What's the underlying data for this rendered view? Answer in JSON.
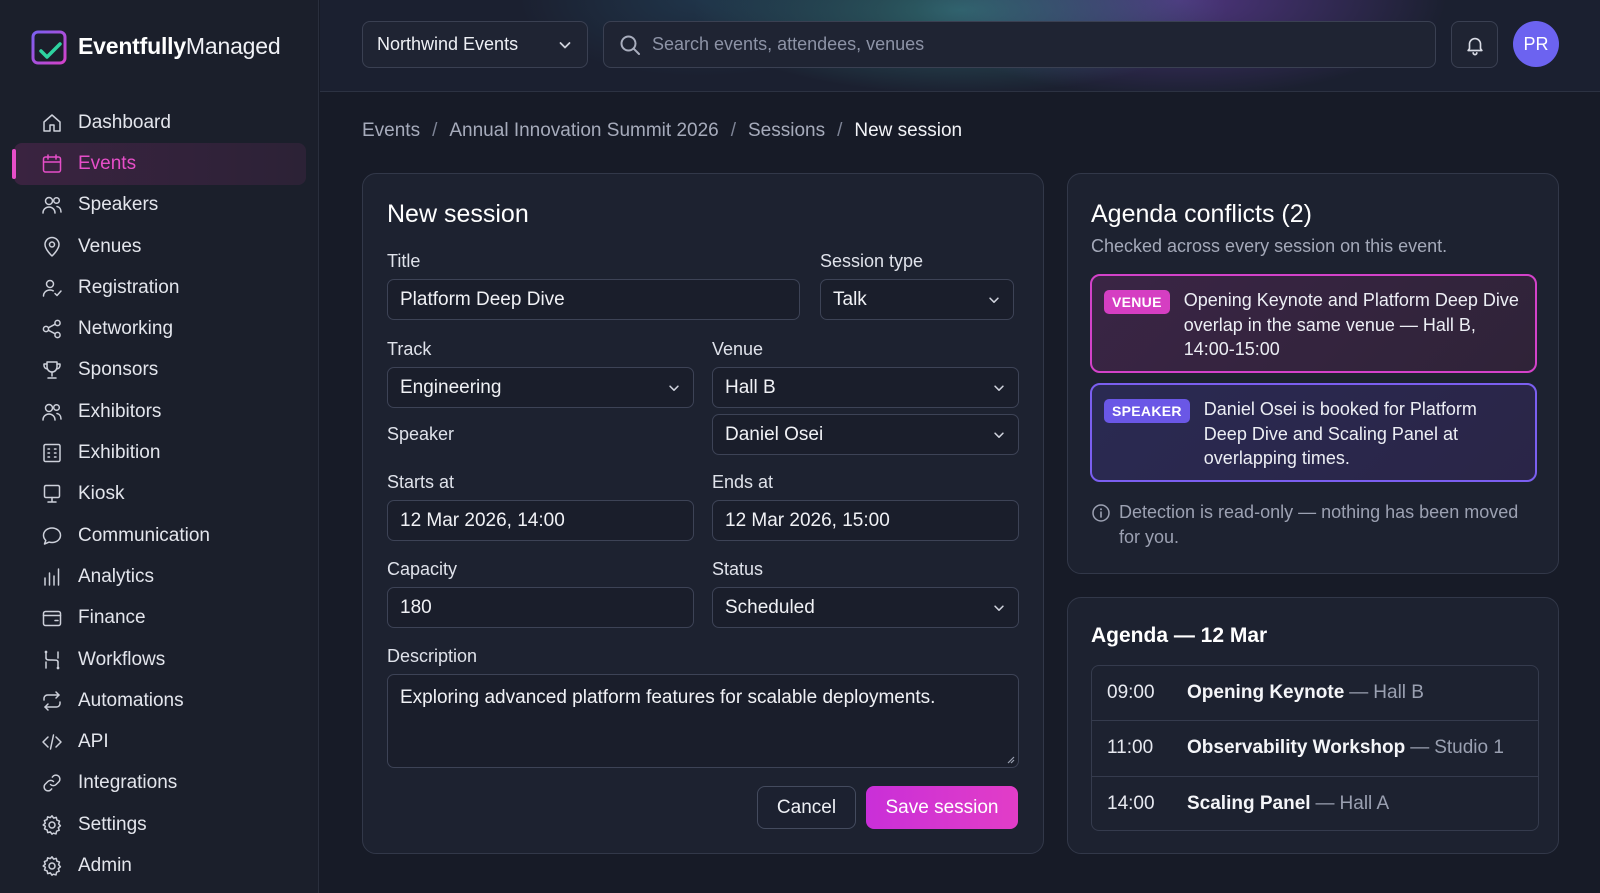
{
  "brand": {
    "name_strong": "Eventfully",
    "name_light": "Managed"
  },
  "sidebar": {
    "items": [
      {
        "label": "Dashboard",
        "icon": "home-icon",
        "active": false
      },
      {
        "label": "Events",
        "icon": "calendar-icon",
        "active": true
      },
      {
        "label": "Speakers",
        "icon": "users-icon",
        "active": false
      },
      {
        "label": "Venues",
        "icon": "map-pin-icon",
        "active": false
      },
      {
        "label": "Registration",
        "icon": "user-check-icon",
        "active": false
      },
      {
        "label": "Networking",
        "icon": "share-icon",
        "active": false
      },
      {
        "label": "Sponsors",
        "icon": "trophy-icon",
        "active": false
      },
      {
        "label": "Exhibitors",
        "icon": "users-icon",
        "active": false
      },
      {
        "label": "Exhibition",
        "icon": "grid-building-icon",
        "active": false
      },
      {
        "label": "Kiosk",
        "icon": "monitor-icon",
        "active": false
      },
      {
        "label": "Communication",
        "icon": "chat-icon",
        "active": false
      },
      {
        "label": "Analytics",
        "icon": "bar-chart-icon",
        "active": false
      },
      {
        "label": "Finance",
        "icon": "wallet-icon",
        "active": false
      },
      {
        "label": "Workflows",
        "icon": "workflow-icon",
        "active": false
      },
      {
        "label": "Automations",
        "icon": "repeat-icon",
        "active": false
      },
      {
        "label": "API",
        "icon": "code-icon",
        "active": false
      },
      {
        "label": "Integrations",
        "icon": "link-icon",
        "active": false
      },
      {
        "label": "Settings",
        "icon": "gear-icon",
        "active": false
      },
      {
        "label": "Admin",
        "icon": "gear-icon",
        "active": false
      }
    ]
  },
  "topbar": {
    "org": "Northwind Events",
    "search_placeholder": "Search events, attendees, venues",
    "avatar_initials": "PR"
  },
  "breadcrumb": {
    "items": [
      "Events",
      "Annual Innovation Summit 2026",
      "Sessions"
    ],
    "current": "New session"
  },
  "form": {
    "title": "New session",
    "title_label": "Title",
    "title_value": "Platform Deep Dive",
    "session_type_label": "Session type",
    "session_type_value": "Talk",
    "track_label": "Track",
    "track_value": "Engineering",
    "venue_label": "Venue",
    "venue_value": "Hall B",
    "speaker_label": "Speaker",
    "speaker_value": "Daniel Osei",
    "starts_label": "Starts at",
    "starts_value": "12 Mar 2026, 14:00",
    "ends_label": "Ends at",
    "ends_value": "12 Mar 2026, 15:00",
    "capacity_label": "Capacity",
    "capacity_value": "180",
    "status_label": "Status",
    "status_value": "Scheduled",
    "description_label": "Description",
    "description_value": "Exploring advanced platform features for scalable deployments.",
    "cancel_label": "Cancel",
    "save_label": "Save session"
  },
  "conflicts": {
    "title": "Agenda conflicts (2)",
    "subtitle": "Checked across every session on this event.",
    "items": [
      {
        "tag": "VENUE",
        "text": "Opening Keynote and Platform Deep Dive overlap in the same venue — Hall B, 14:00-15:00",
        "color": "#d53ec2"
      },
      {
        "tag": "SPEAKER",
        "text": "Daniel Osei is booked for Platform Deep Dive and Scaling Panel at overlapping times.",
        "color": "#6a57e6"
      }
    ],
    "note": "Detection is read-only — nothing has been moved for you."
  },
  "agenda": {
    "title": "Agenda — 12 Mar",
    "rows": [
      {
        "time": "09:00",
        "name": "Opening Keynote",
        "room": "Hall B"
      },
      {
        "time": "11:00",
        "name": "Observability Workshop",
        "room": "Studio 1"
      },
      {
        "time": "14:00",
        "name": "Scaling Panel",
        "room": "Hall A"
      }
    ]
  },
  "colors": {
    "accent": "#e64ec8",
    "background": "#171b27",
    "avatar": "#6c63f0"
  }
}
